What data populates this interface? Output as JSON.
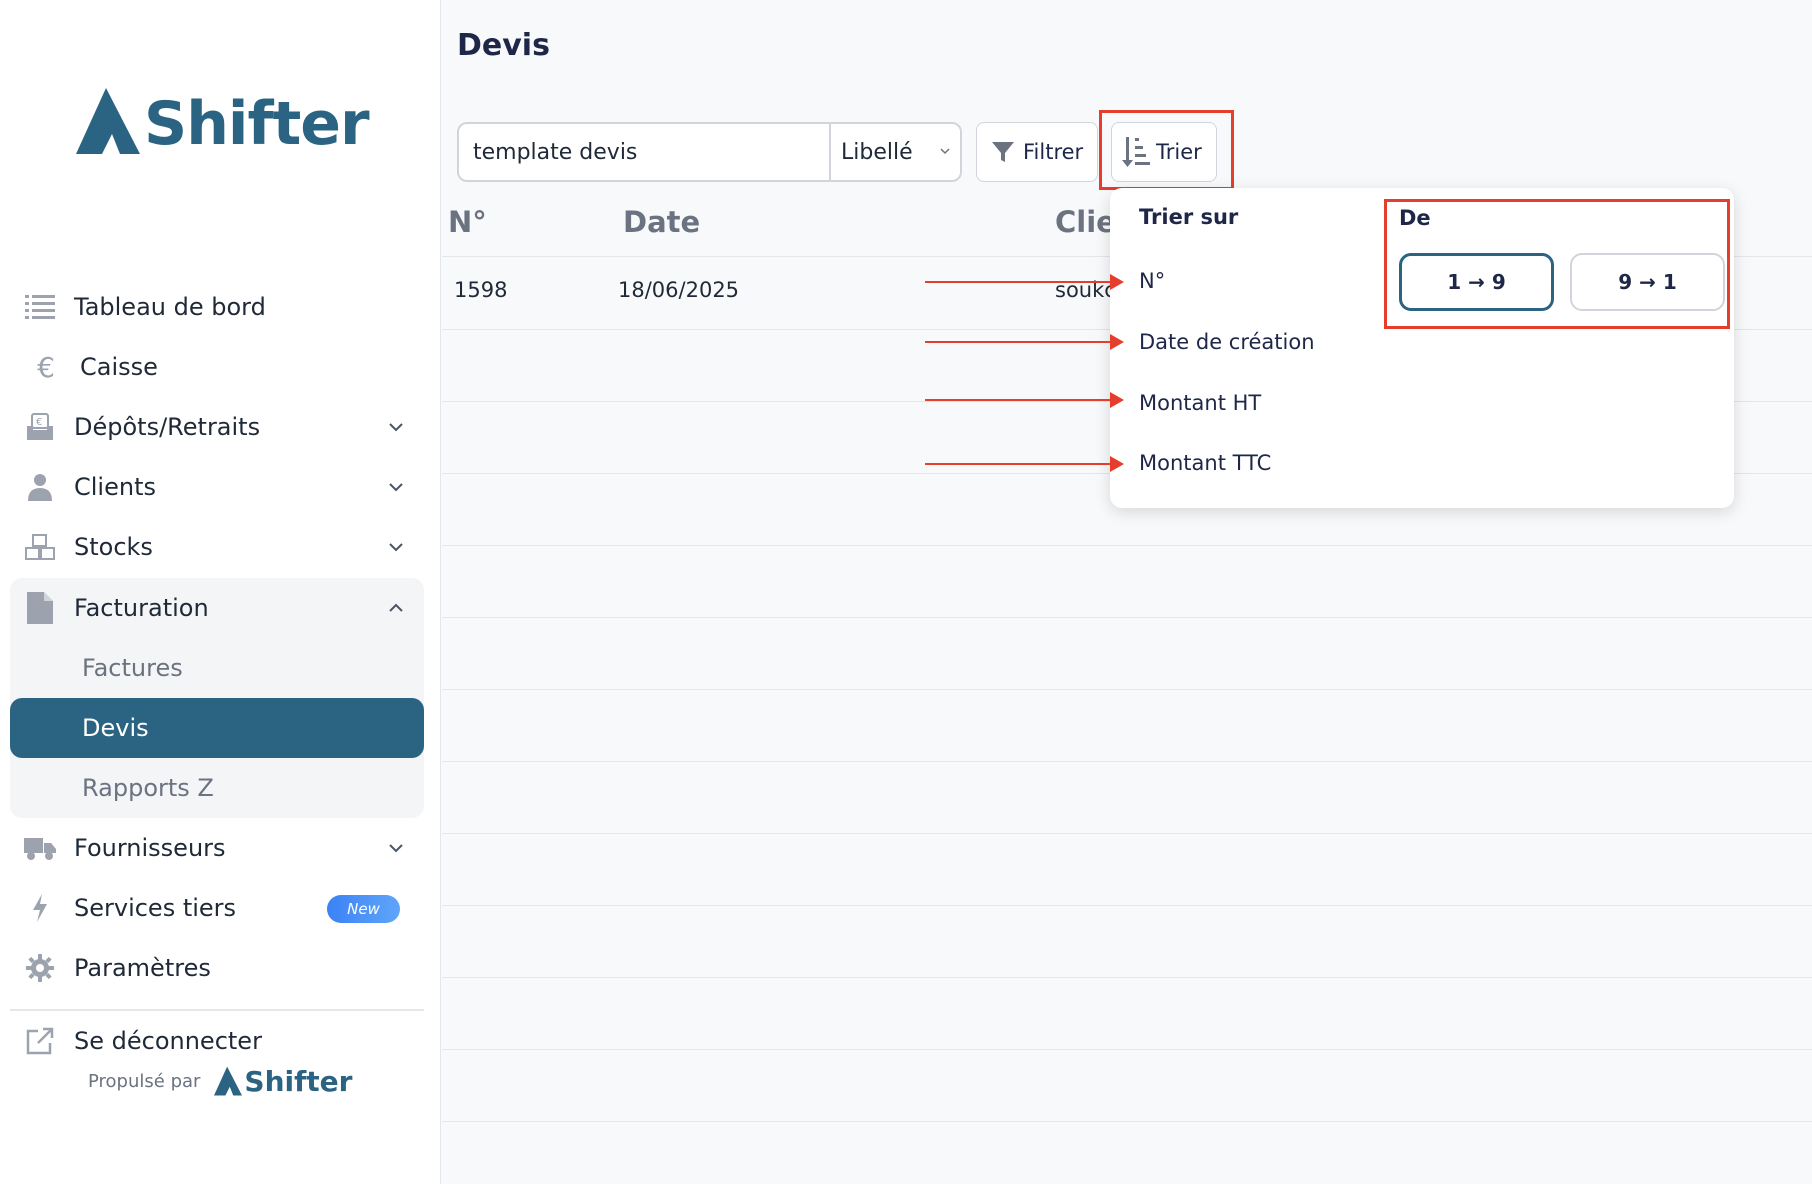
{
  "page": {
    "title": "Devis"
  },
  "sidebar": {
    "logo": "Shifter",
    "items": [
      {
        "label": "Tableau de bord",
        "icon": "list-icon"
      },
      {
        "label": "Caisse",
        "icon": "euro-icon"
      },
      {
        "label": "Dépôts/Retraits",
        "icon": "deposit-icon"
      },
      {
        "label": "Clients",
        "icon": "user-icon"
      },
      {
        "label": "Stocks",
        "icon": "boxes-icon"
      },
      {
        "label": "Facturation",
        "icon": "document-icon"
      },
      {
        "label": "Fournisseurs",
        "icon": "truck-icon"
      },
      {
        "label": "Services tiers",
        "icon": "lightning-icon",
        "badge": "New"
      },
      {
        "label": "Paramètres",
        "icon": "gear-icon"
      }
    ],
    "facturation_sub": [
      {
        "label": "Factures"
      },
      {
        "label": "Devis",
        "active": true
      },
      {
        "label": "Rapports Z"
      }
    ],
    "logout": "Se déconnecter",
    "powered_by": "Propulsé par",
    "powered_logo": "Shifter"
  },
  "toolbar": {
    "search_value": "template devis",
    "field_select": "Libellé",
    "filter_label": "Filtrer",
    "sort_label": "Trier"
  },
  "table": {
    "headers": [
      "N°",
      "Date",
      "Clie"
    ],
    "rows": [
      {
        "number": "1598",
        "date": "18/06/2025",
        "client": "soukc"
      }
    ]
  },
  "sort_popover": {
    "sort_on_label": "Trier sur",
    "options": [
      "N°",
      "Date de création",
      "Montant HT",
      "Montant TTC"
    ],
    "order_label": "De",
    "orders": [
      "1 → 9",
      "9 → 1"
    ],
    "selected_order": "1 → 9"
  },
  "colors": {
    "brand": "#2a6482",
    "annotation": "#e53e2d",
    "badge": "#3b82f6"
  }
}
